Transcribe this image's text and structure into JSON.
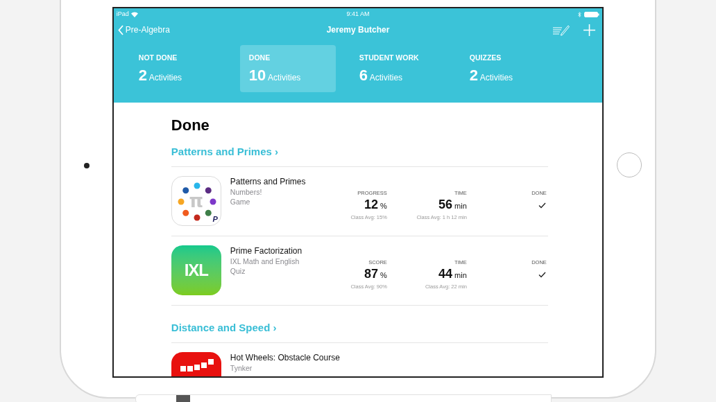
{
  "status_bar": {
    "device": "iPad",
    "time": "9:41 AM"
  },
  "nav": {
    "back": "Pre-Algebra",
    "title": "Jeremy Butcher"
  },
  "tabs": [
    {
      "label": "NOT DONE",
      "count": "2",
      "unit": "Activities",
      "selected": false
    },
    {
      "label": "DONE",
      "count": "10",
      "unit": "Activities",
      "selected": true
    },
    {
      "label": "STUDENT WORK",
      "count": "6",
      "unit": "Activities",
      "selected": false
    },
    {
      "label": "QUIZZES",
      "count": "2",
      "unit": "Activities",
      "selected": false
    }
  ],
  "page_title": "Done",
  "sections": [
    {
      "title": "Patterns and Primes",
      "chevron": "›",
      "activities": [
        {
          "title": "Patterns and Primes",
          "app": "Numbers!",
          "type": "Game",
          "icon": {
            "kind": "dots",
            "glyph": "π",
            "badge": "P"
          },
          "metrics": [
            {
              "label": "PROGRESS",
              "value": "12",
              "unit": "%",
              "avg": "Class Avg: 15%"
            },
            {
              "label": "TIME",
              "value": "56",
              "unit": "min",
              "avg": "Class Avg: 1 h 12 min"
            }
          ],
          "done_label": "DONE",
          "done": true
        },
        {
          "title": "Prime Factorization",
          "app": "IXL Math and English",
          "type": "Quiz",
          "icon": {
            "kind": "ixl",
            "glyph": "IXL"
          },
          "metrics": [
            {
              "label": "SCORE",
              "value": "87",
              "unit": "%",
              "avg": "Class Avg: 90%"
            },
            {
              "label": "TIME",
              "value": "44",
              "unit": "min",
              "avg": "Class Avg: 22 min"
            }
          ],
          "done_label": "DONE",
          "done": true
        }
      ]
    },
    {
      "title": "Distance and Speed",
      "chevron": "›",
      "activities": [
        {
          "title": "Hot Wheels: Obstacle Course",
          "app": "Tynker",
          "icon": {
            "kind": "blocks"
          }
        }
      ]
    }
  ]
}
